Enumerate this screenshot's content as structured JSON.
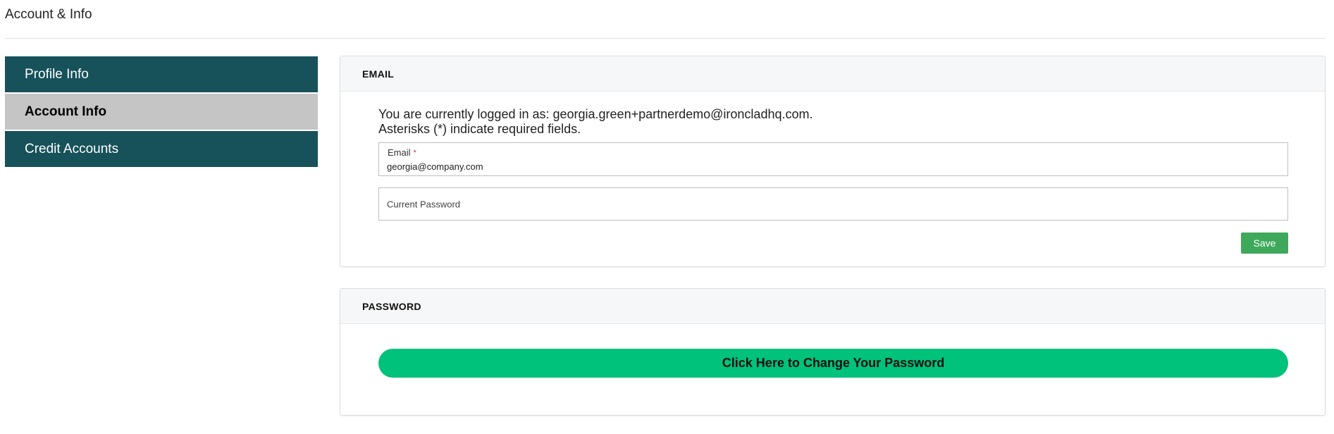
{
  "page": {
    "title": "Account & Info"
  },
  "sidebar": {
    "items": [
      {
        "label": "Profile Info",
        "active": false
      },
      {
        "label": "Account Info",
        "active": true
      },
      {
        "label": "Credit Accounts",
        "active": false
      }
    ]
  },
  "email_section": {
    "header": "EMAIL",
    "logged_in_text": "You are currently logged in as: georgia.green+partnerdemo@ironcladhq.com.",
    "required_note": "Asterisks (*) indicate required fields.",
    "email_field": {
      "label": "Email",
      "required_marker": "*",
      "value": "georgia@company.com"
    },
    "password_field": {
      "placeholder": "Current Password",
      "value": ""
    },
    "save_label": "Save"
  },
  "password_section": {
    "header": "PASSWORD",
    "change_button_label": "Click Here to Change Your Password"
  },
  "colors": {
    "sidebar_dark": "#17515a",
    "sidebar_active": "#c5c5c5",
    "save_green": "#3ea95b",
    "change_password_green": "#00c27b",
    "required_red": "#d9302c"
  }
}
